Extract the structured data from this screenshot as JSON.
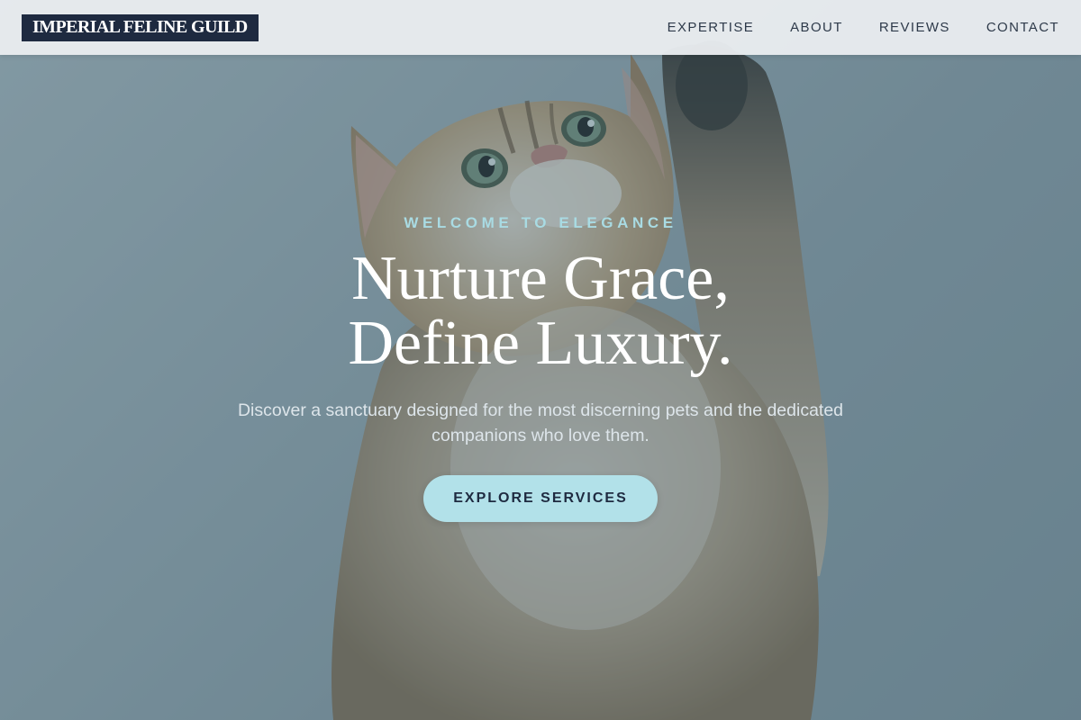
{
  "brand": {
    "name": "IMPERIAL FELINE GUILD"
  },
  "nav": {
    "items": [
      {
        "label": "EXPERTISE"
      },
      {
        "label": "ABOUT"
      },
      {
        "label": "REVIEWS"
      },
      {
        "label": "CONTACT"
      }
    ]
  },
  "hero": {
    "eyebrow": "WELCOME TO ELEGANCE",
    "headline_line1": "Nurture Grace,",
    "headline_line2": "Define Luxury.",
    "subtext": "Discover a sanctuary designed for the most discerning pets and the dedicated companions who love them.",
    "cta_label": "EXPLORE SERVICES",
    "background_image": "kitten-reaching-up-photo"
  },
  "colors": {
    "brand_dark": "#1e2a40",
    "accent_aqua": "#b2e1e9",
    "eyebrow_aqua": "#a9dbe3",
    "header_bg": "#e9ecef"
  }
}
